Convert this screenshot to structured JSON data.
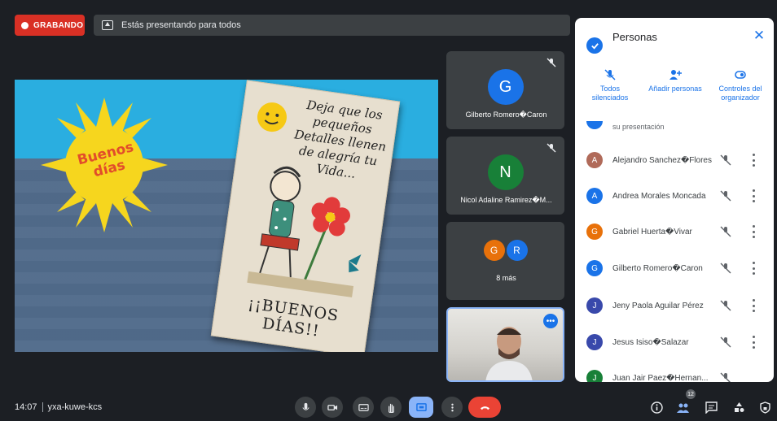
{
  "top_bar": {
    "recording_label": "GRABANDO",
    "presenting_text": "Estás presentando para todos"
  },
  "slide": {
    "sun_text_line1": "Buenos",
    "sun_text_line2": "días",
    "card_text": "Deja que los pequeños Detalles llenen de alegría tu Vida...",
    "card_footer": "¡¡BUENOS DÍAS!!",
    "colors": {
      "sky": "#2aaee0",
      "sun": "#f6d61e",
      "floor": "#546a86"
    }
  },
  "tiles": [
    {
      "initial": "G",
      "name": "Gilberto Romero\u0000Caron",
      "avatar_color": "#1a73e8",
      "muted": true
    },
    {
      "initial": "N",
      "name": "Nicol Adaline Ramirez\u0000M...",
      "avatar_color": "#188038",
      "muted": true
    }
  ],
  "more_tile": {
    "avatars": [
      {
        "initial": "G",
        "color": "#e8710a"
      },
      {
        "initial": "R",
        "color": "#1a73e8"
      }
    ],
    "label": "8 más"
  },
  "people_panel": {
    "title": "Personas",
    "actions": [
      {
        "icon": "mic-off-icon",
        "label": "Todos silenciados"
      },
      {
        "icon": "add-person-icon",
        "label": "Añadir personas"
      },
      {
        "icon": "host-controls-icon",
        "label": "Controles del organizador"
      }
    ],
    "partial_row_text": "su presentación",
    "participants": [
      {
        "initial": "A",
        "name": "Alejandro Sanchez\u0000Flores",
        "color": "#b06a59"
      },
      {
        "initial": "A",
        "name": "Andrea Morales Moncada",
        "color": "#1a73e8"
      },
      {
        "initial": "G",
        "name": "Gabriel Huerta\u0000Vivar",
        "color": "#e8710a"
      },
      {
        "initial": "G",
        "name": "Gilberto Romero\u0000Caron",
        "color": "#1a73e8"
      },
      {
        "initial": "J",
        "name": "Jeny Paola Aguilar Pérez",
        "color": "#3949ab"
      },
      {
        "initial": "J",
        "name": "Jesus Isiso\u0000Salazar",
        "color": "#3949ab"
      },
      {
        "initial": "J",
        "name": "Juan Jair Paez\u0000Hernan...",
        "color": "#188038"
      }
    ]
  },
  "bottom_bar": {
    "time": "14:07",
    "meeting_code": "yxa-kuwe-kcs",
    "participant_count": "12"
  }
}
